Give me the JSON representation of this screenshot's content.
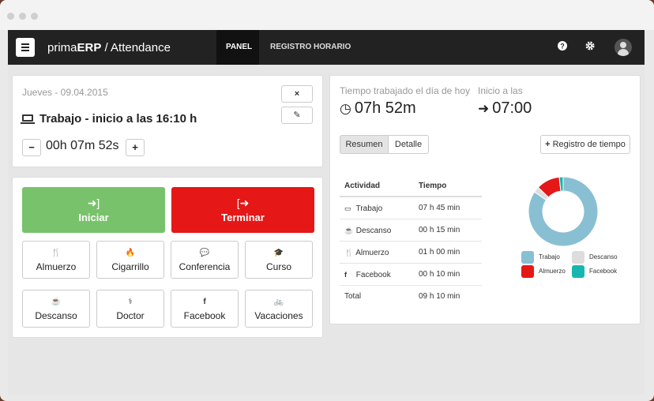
{
  "app": {
    "brand_prefix": "prima",
    "brand_bold": "ERP",
    "brand_suffix": " / Attendance",
    "tabs": [
      {
        "label": "PANEL"
      },
      {
        "label": "REGISTRO HORARIO"
      }
    ],
    "icons": {
      "help": "question-icon",
      "settings": "gear-icon",
      "user": "user-avatar-icon"
    }
  },
  "status": {
    "date": "Jueves - 09.04.2015",
    "activity_line": "Trabajo - inicio a las 16:10 h",
    "duration": "00h 07m 52s",
    "close_label": "×",
    "edit_label": "✎",
    "minus_label": "−",
    "plus_label": "+"
  },
  "actions": {
    "start": {
      "label": "Iniciar",
      "icon": "sign-in-icon",
      "color": "#78c26b"
    },
    "stop": {
      "label": "Terminar",
      "icon": "sign-out-icon",
      "color": "#e51717"
    },
    "activities": [
      {
        "label": "Almuerzo",
        "icon": "cutlery-icon",
        "glyph": "🍴"
      },
      {
        "label": "Cigarrillo",
        "icon": "fire-icon",
        "glyph": "🔥"
      },
      {
        "label": "Conferencia",
        "icon": "comments-icon",
        "glyph": "💬"
      },
      {
        "label": "Curso",
        "icon": "graduation-cap-icon",
        "glyph": "🎓"
      },
      {
        "label": "Descanso",
        "icon": "coffee-icon",
        "glyph": "☕"
      },
      {
        "label": "Doctor",
        "icon": "stethoscope-icon",
        "glyph": "⚕"
      },
      {
        "label": "Facebook",
        "icon": "facebook-icon",
        "glyph": "f"
      },
      {
        "label": "Vacaciones",
        "icon": "bicycle-icon",
        "glyph": "🚲"
      }
    ]
  },
  "summary": {
    "worked_label": "Tiempo trabajado el día de hoy",
    "worked_value": "07h 52m",
    "start_label": "Inicio a las",
    "start_value": "07:00",
    "view_tabs": [
      {
        "label": "Resumen"
      },
      {
        "label": "Detalle"
      }
    ],
    "register_button": "Registro de tiempo",
    "table": {
      "headers": [
        "Actividad",
        "Tiempo"
      ],
      "rows": [
        {
          "activity": "Trabajo",
          "time": "07 h 45 min",
          "icon": "laptop-icon"
        },
        {
          "activity": "Descanso",
          "time": "00 h 15 min",
          "icon": "coffee-icon"
        },
        {
          "activity": "Almuerzo",
          "time": "01 h 00 min",
          "icon": "cutlery-icon"
        },
        {
          "activity": "Facebook",
          "time": "00 h 10 min",
          "icon": "facebook-icon"
        }
      ],
      "total_label": "Total",
      "total_value": "09 h 10 min"
    }
  },
  "chart_data": {
    "type": "pie",
    "categories": [
      "Trabajo",
      "Descanso",
      "Almuerzo",
      "Facebook"
    ],
    "values": [
      465,
      15,
      60,
      10
    ],
    "colors": [
      "#89bfd3",
      "#dddddd",
      "#e51717",
      "#17b7b0"
    ],
    "legend_position": "bottom"
  }
}
